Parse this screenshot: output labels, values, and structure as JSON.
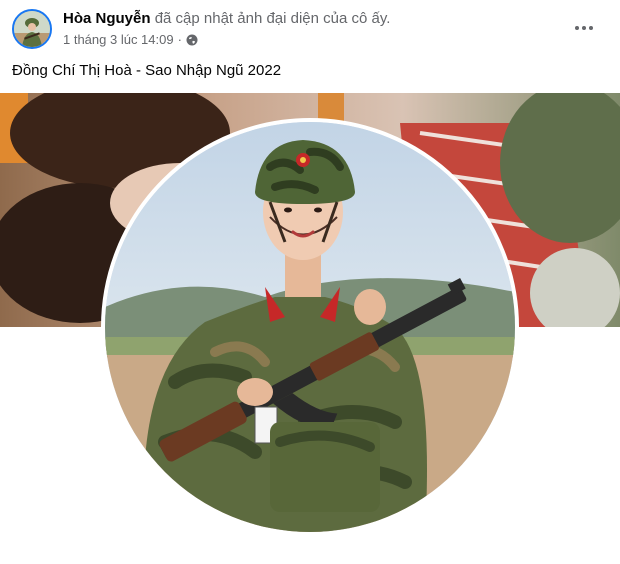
{
  "post": {
    "author_name": "Hòa Nguyễn",
    "action_text": "đã cập nhật ảnh đại diện của cô ấy.",
    "timestamp": "1 tháng 3 lúc 14:09",
    "separator": "·",
    "audience_icon": "globe-icon",
    "more_icon": "more-options-icon",
    "caption": "Đồng Chí Thị Hoà - Sao Nhập Ngũ 2022"
  },
  "colors": {
    "profile_ring": "#1877f2",
    "secondary_text": "#65676b",
    "primary_text": "#050505"
  }
}
